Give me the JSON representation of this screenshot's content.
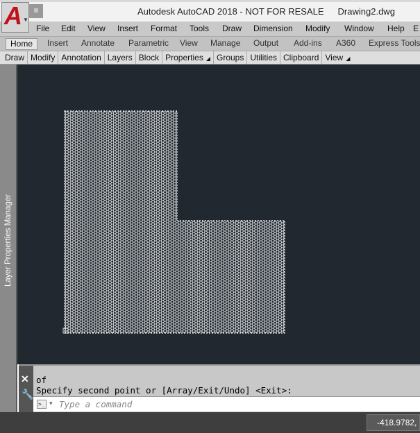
{
  "app": {
    "title": "Autodesk AutoCAD 2018 - NOT FOR RESALE",
    "document": "Drawing2.dwg",
    "logo_letter": "A"
  },
  "menu": [
    "File",
    "Edit",
    "View",
    "Insert",
    "Format",
    "Tools",
    "Draw",
    "Dimension",
    "Modify",
    "Window",
    "Help",
    "E"
  ],
  "ribbon_tabs": [
    {
      "label": "Home",
      "active": true
    },
    {
      "label": "Insert"
    },
    {
      "label": "Annotate"
    },
    {
      "label": "Parametric"
    },
    {
      "label": "View"
    },
    {
      "label": "Manage"
    },
    {
      "label": "Output"
    },
    {
      "label": "Add-ins"
    },
    {
      "label": "A360"
    },
    {
      "label": "Express Tools"
    }
  ],
  "panels": [
    "Draw",
    "Modify",
    "Annotation",
    "Layers",
    "Block",
    "Properties",
    "Groups",
    "Utilities",
    "Clipboard",
    "View"
  ],
  "palette": {
    "label": "Layer Properties Manager"
  },
  "command": {
    "history": [
      "of",
      "Specify second point or [Array/Exit/Undo] <Exit>:"
    ],
    "placeholder": "Type a command"
  },
  "status": {
    "coordinates": "-418.9782,"
  },
  "colors": {
    "canvas": "#212830",
    "mesh": "#ffffff",
    "logo": "#c0121b"
  },
  "icons": {
    "close": "close-icon",
    "settings": "wrench-icon",
    "prompt": "command-prompt-icon"
  }
}
